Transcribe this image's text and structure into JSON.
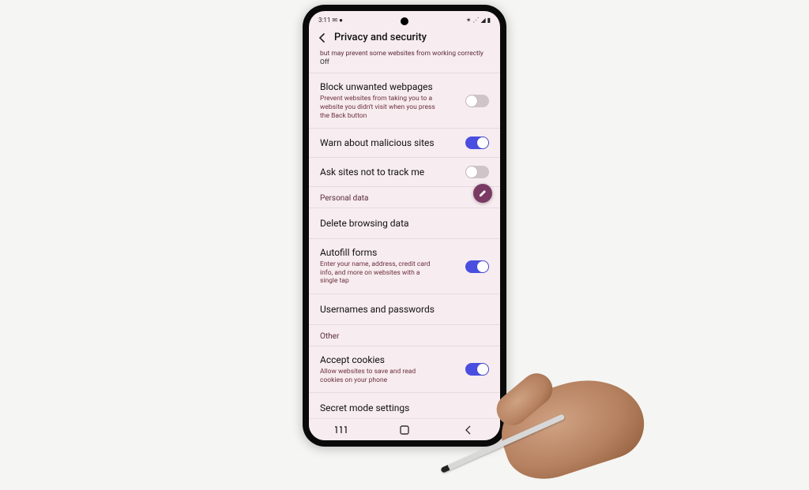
{
  "status": {
    "time": "3:11",
    "icons_left": "✉ ●",
    "icons_right": "✶ ⋰ ◢ ▮"
  },
  "header": {
    "title": "Privacy and security"
  },
  "partial_item": {
    "desc": "but may prevent some websites from working correctly",
    "value": "Off"
  },
  "items": {
    "block_unwanted": {
      "label": "Block unwanted webpages",
      "desc": "Prevent websites from taking you to a website you didn't visit when you press the Back button",
      "on": false
    },
    "warn_malicious": {
      "label": "Warn about malicious sites",
      "on": true
    },
    "do_not_track": {
      "label": "Ask sites not to track me",
      "on": false
    }
  },
  "sections": {
    "personal_data": "Personal data",
    "other": "Other"
  },
  "personal": {
    "delete": {
      "label": "Delete browsing data"
    },
    "autofill": {
      "label": "Autofill forms",
      "desc": "Enter your name, address, credit card info, and more on websites with a single tap",
      "on": true
    },
    "usernames": {
      "label": "Usernames and passwords"
    }
  },
  "other": {
    "cookies": {
      "label": "Accept cookies",
      "desc": "Allow websites to save and read cookies on your phone",
      "on": true
    },
    "secret": {
      "label": "Secret mode settings"
    }
  },
  "colors": {
    "accent": "#4a4ee0",
    "fab": "#7a3a64",
    "subtext": "#6b3040"
  }
}
